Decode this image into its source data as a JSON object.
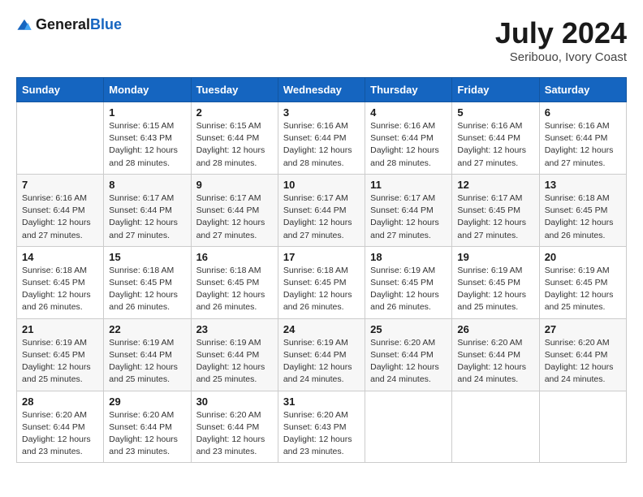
{
  "header": {
    "logo_general": "General",
    "logo_blue": "Blue",
    "month": "July 2024",
    "location": "Seribouo, Ivory Coast"
  },
  "weekdays": [
    "Sunday",
    "Monday",
    "Tuesday",
    "Wednesday",
    "Thursday",
    "Friday",
    "Saturday"
  ],
  "weeks": [
    [
      {
        "day": "",
        "info": ""
      },
      {
        "day": "1",
        "info": "Sunrise: 6:15 AM\nSunset: 6:43 PM\nDaylight: 12 hours\nand 28 minutes."
      },
      {
        "day": "2",
        "info": "Sunrise: 6:15 AM\nSunset: 6:44 PM\nDaylight: 12 hours\nand 28 minutes."
      },
      {
        "day": "3",
        "info": "Sunrise: 6:16 AM\nSunset: 6:44 PM\nDaylight: 12 hours\nand 28 minutes."
      },
      {
        "day": "4",
        "info": "Sunrise: 6:16 AM\nSunset: 6:44 PM\nDaylight: 12 hours\nand 28 minutes."
      },
      {
        "day": "5",
        "info": "Sunrise: 6:16 AM\nSunset: 6:44 PM\nDaylight: 12 hours\nand 27 minutes."
      },
      {
        "day": "6",
        "info": "Sunrise: 6:16 AM\nSunset: 6:44 PM\nDaylight: 12 hours\nand 27 minutes."
      }
    ],
    [
      {
        "day": "7",
        "info": "Sunrise: 6:16 AM\nSunset: 6:44 PM\nDaylight: 12 hours\nand 27 minutes."
      },
      {
        "day": "8",
        "info": "Sunrise: 6:17 AM\nSunset: 6:44 PM\nDaylight: 12 hours\nand 27 minutes."
      },
      {
        "day": "9",
        "info": "Sunrise: 6:17 AM\nSunset: 6:44 PM\nDaylight: 12 hours\nand 27 minutes."
      },
      {
        "day": "10",
        "info": "Sunrise: 6:17 AM\nSunset: 6:44 PM\nDaylight: 12 hours\nand 27 minutes."
      },
      {
        "day": "11",
        "info": "Sunrise: 6:17 AM\nSunset: 6:44 PM\nDaylight: 12 hours\nand 27 minutes."
      },
      {
        "day": "12",
        "info": "Sunrise: 6:17 AM\nSunset: 6:45 PM\nDaylight: 12 hours\nand 27 minutes."
      },
      {
        "day": "13",
        "info": "Sunrise: 6:18 AM\nSunset: 6:45 PM\nDaylight: 12 hours\nand 26 minutes."
      }
    ],
    [
      {
        "day": "14",
        "info": "Sunrise: 6:18 AM\nSunset: 6:45 PM\nDaylight: 12 hours\nand 26 minutes."
      },
      {
        "day": "15",
        "info": "Sunrise: 6:18 AM\nSunset: 6:45 PM\nDaylight: 12 hours\nand 26 minutes."
      },
      {
        "day": "16",
        "info": "Sunrise: 6:18 AM\nSunset: 6:45 PM\nDaylight: 12 hours\nand 26 minutes."
      },
      {
        "day": "17",
        "info": "Sunrise: 6:18 AM\nSunset: 6:45 PM\nDaylight: 12 hours\nand 26 minutes."
      },
      {
        "day": "18",
        "info": "Sunrise: 6:19 AM\nSunset: 6:45 PM\nDaylight: 12 hours\nand 26 minutes."
      },
      {
        "day": "19",
        "info": "Sunrise: 6:19 AM\nSunset: 6:45 PM\nDaylight: 12 hours\nand 25 minutes."
      },
      {
        "day": "20",
        "info": "Sunrise: 6:19 AM\nSunset: 6:45 PM\nDaylight: 12 hours\nand 25 minutes."
      }
    ],
    [
      {
        "day": "21",
        "info": "Sunrise: 6:19 AM\nSunset: 6:45 PM\nDaylight: 12 hours\nand 25 minutes."
      },
      {
        "day": "22",
        "info": "Sunrise: 6:19 AM\nSunset: 6:44 PM\nDaylight: 12 hours\nand 25 minutes."
      },
      {
        "day": "23",
        "info": "Sunrise: 6:19 AM\nSunset: 6:44 PM\nDaylight: 12 hours\nand 25 minutes."
      },
      {
        "day": "24",
        "info": "Sunrise: 6:19 AM\nSunset: 6:44 PM\nDaylight: 12 hours\nand 24 minutes."
      },
      {
        "day": "25",
        "info": "Sunrise: 6:20 AM\nSunset: 6:44 PM\nDaylight: 12 hours\nand 24 minutes."
      },
      {
        "day": "26",
        "info": "Sunrise: 6:20 AM\nSunset: 6:44 PM\nDaylight: 12 hours\nand 24 minutes."
      },
      {
        "day": "27",
        "info": "Sunrise: 6:20 AM\nSunset: 6:44 PM\nDaylight: 12 hours\nand 24 minutes."
      }
    ],
    [
      {
        "day": "28",
        "info": "Sunrise: 6:20 AM\nSunset: 6:44 PM\nDaylight: 12 hours\nand 23 minutes."
      },
      {
        "day": "29",
        "info": "Sunrise: 6:20 AM\nSunset: 6:44 PM\nDaylight: 12 hours\nand 23 minutes."
      },
      {
        "day": "30",
        "info": "Sunrise: 6:20 AM\nSunset: 6:44 PM\nDaylight: 12 hours\nand 23 minutes."
      },
      {
        "day": "31",
        "info": "Sunrise: 6:20 AM\nSunset: 6:43 PM\nDaylight: 12 hours\nand 23 minutes."
      },
      {
        "day": "",
        "info": ""
      },
      {
        "day": "",
        "info": ""
      },
      {
        "day": "",
        "info": ""
      }
    ]
  ]
}
